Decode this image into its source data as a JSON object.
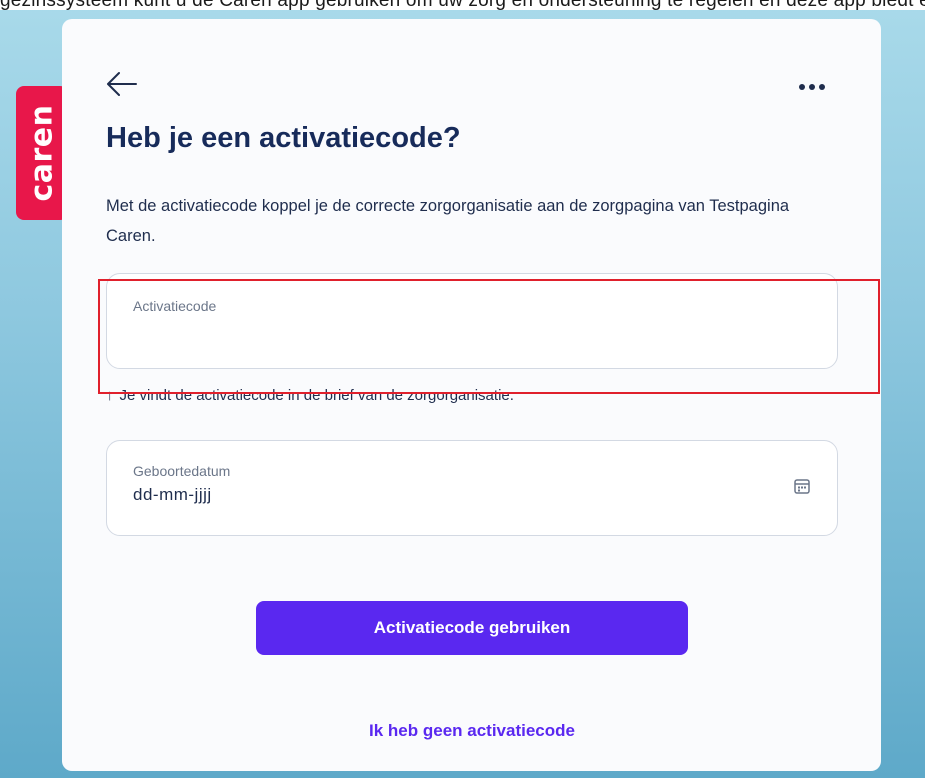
{
  "banner": {
    "text": "gezinssysteem kunt u de Caren app gebruiken om uw zorg en ondersteuning te regelen en deze app biedt een veilige koppeling met uw zorggegevens op"
  },
  "brand": {
    "logo_text": "caren",
    "color": "#e8174a"
  },
  "header": {
    "back_icon": "arrow-left-icon",
    "more_icon": "more-horizontal-icon"
  },
  "main": {
    "title": "Heb je een activatiecode?",
    "description": "Met de activatiecode koppel je de correcte zorgorganisatie aan de zorgpagina van Testpagina Caren.",
    "code_field": {
      "label": "Activatiecode",
      "value": ""
    },
    "hint": {
      "icon": "arrow-up-icon",
      "text": "Je vindt de activatiecode in de brief van de zorgorganisatie."
    },
    "date_field": {
      "label": "Geboortedatum",
      "value": "dd-mm-jjjj",
      "icon": "calendar-icon"
    },
    "primary_button": "Activatiecode gebruiken",
    "secondary_link": "Ik heb geen activatiecode"
  },
  "colors": {
    "accent": "#5a28f0",
    "title": "#172b5a",
    "highlight": "#e0202c"
  }
}
